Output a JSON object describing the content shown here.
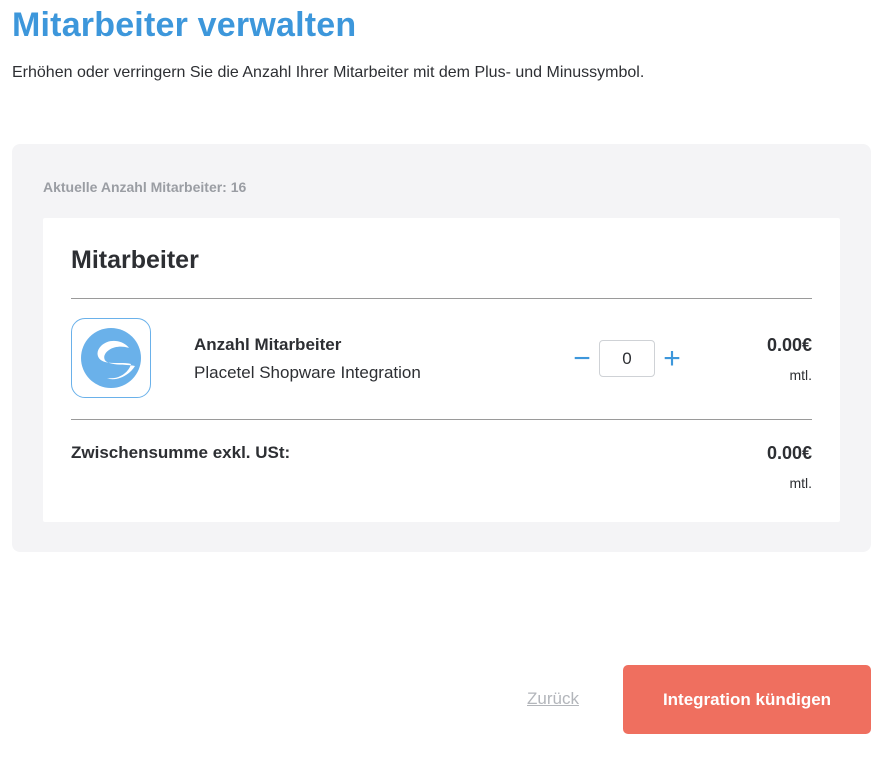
{
  "header": {
    "title": "Mitarbeiter verwalten",
    "subtitle": "Erhöhen oder verringern Sie die Anzahl Ihrer Mitarbeiter mit dem Plus- und Minussymbol."
  },
  "panel": {
    "current_count_label": "Aktuelle Anzahl Mitarbeiter: 16"
  },
  "card": {
    "title": "Mitarbeiter",
    "item": {
      "logo_icon": "shopware-logo-icon",
      "name": "Anzahl Mitarbeiter",
      "description": "Placetel Shopware Integration",
      "decrement_symbol": "−",
      "increment_symbol": "+",
      "quantity": "0",
      "price": "0.00€",
      "period": "mtl."
    },
    "subtotal": {
      "label": "Zwischensumme exkl. USt:",
      "price": "0.00€",
      "period": "mtl."
    }
  },
  "footer": {
    "back_label": "Zurück",
    "primary_label": "Integration kündigen"
  },
  "colors": {
    "accent": "#3d97db",
    "primary_button": "#ef6f5f",
    "panel_bg": "#f4f4f6",
    "muted_text": "#9a9da3"
  }
}
